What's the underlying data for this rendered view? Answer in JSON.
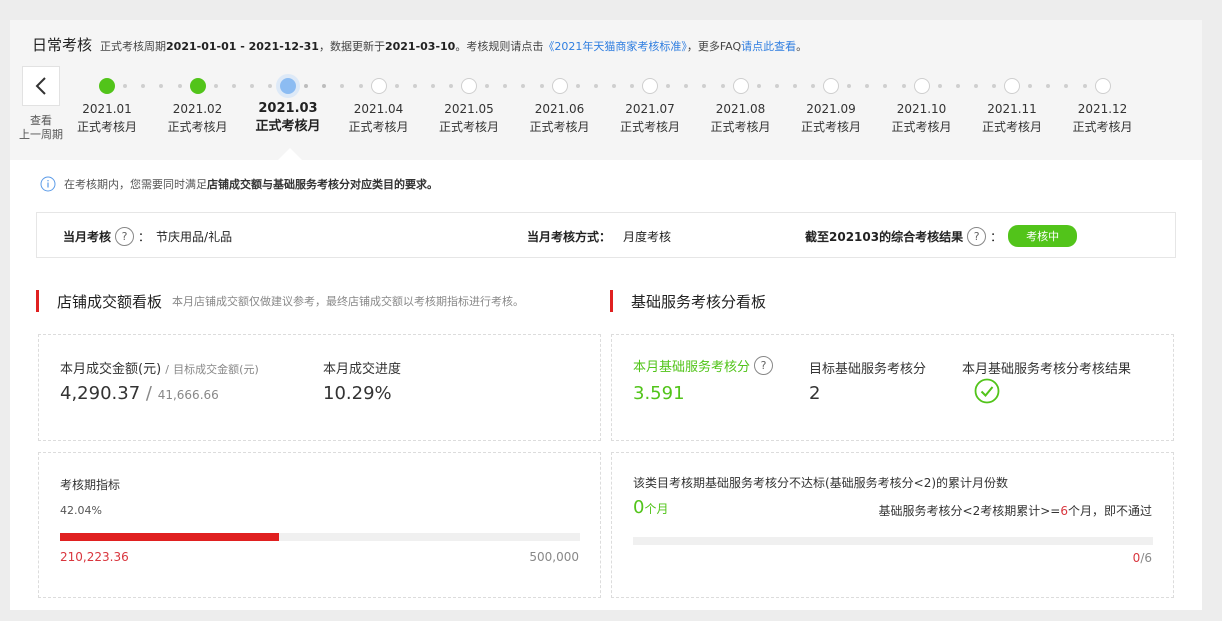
{
  "header": {
    "title": "日常考核",
    "desc_prefix": "正式考核周期",
    "period": "2021-01-01 - 2021-12-31",
    "desc_mid": "，数据更新于",
    "update_date": "2021-03-10",
    "desc_rule": "。考核规则请点击",
    "rule_link": "《2021年天猫商家考核标准》",
    "desc_faq": "，更多FAQ",
    "faq_link": "请点此查看",
    "desc_end": "。"
  },
  "back": {
    "caption_line1": "查看",
    "caption_line2": "上一周期"
  },
  "timeline": {
    "months": [
      {
        "month": "2021.01",
        "label": "正式考核月",
        "status": "done"
      },
      {
        "month": "2021.02",
        "label": "正式考核月",
        "status": "done"
      },
      {
        "month": "2021.03",
        "label": "正式考核月",
        "status": "current"
      },
      {
        "month": "2021.04",
        "label": "正式考核月",
        "status": "future"
      },
      {
        "month": "2021.05",
        "label": "正式考核月",
        "status": "future"
      },
      {
        "month": "2021.06",
        "label": "正式考核月",
        "status": "future"
      },
      {
        "month": "2021.07",
        "label": "正式考核月",
        "status": "future"
      },
      {
        "month": "2021.08",
        "label": "正式考核月",
        "status": "future"
      },
      {
        "month": "2021.09",
        "label": "正式考核月",
        "status": "future"
      },
      {
        "month": "2021.10",
        "label": "正式考核月",
        "status": "future"
      },
      {
        "month": "2021.11",
        "label": "正式考核月",
        "status": "future"
      },
      {
        "month": "2021.12",
        "label": "正式考核月",
        "status": "future"
      }
    ]
  },
  "notice": {
    "prefix": "在考核期内，您需要同时满足",
    "bold": "店铺成交额与基础服务考核分对应类目的要求。"
  },
  "info": {
    "month_label": "当月考核",
    "colon": "：",
    "category": "节庆用品/礼品",
    "method_label": "当月考核方式：",
    "method": "月度考核",
    "result_label": "截至202103的综合考核结果",
    "result_badge": "考核中"
  },
  "sales": {
    "title": "店铺成交额看板",
    "desc": "本月店铺成交额仅做建议参考，最终店铺成交额以考核期指标进行考核。",
    "amount_label": "本月成交金额(元)",
    "slash": "/",
    "target_label": "目标成交金额(元)",
    "amount": "4,290.37",
    "target": "41,666.66",
    "progress_label": "本月成交进度",
    "progress": "10.29%",
    "period_label": "考核期指标",
    "period_percent": "42.04%",
    "period_fraction": 0.4204,
    "period_value": "210,223.36",
    "period_target": "500,000"
  },
  "service": {
    "title": "基础服务考核分看板",
    "score_label": "本月基础服务考核分",
    "score": "3.591",
    "target_label": "目标基础服务考核分",
    "target": "2",
    "result_label": "本月基础服务考核分考核结果",
    "fail_title": "该类目考核期基础服务考核分不达标(基础服务考核分<2)的累计月份数",
    "fail_count": "0",
    "fail_unit": "个月",
    "rule_prefix": "基础服务考核分<2考核期累计>=",
    "rule_num": "6",
    "rule_suffix": "个月，即不通过",
    "fail_fraction": 0,
    "ratio_num": "0",
    "ratio_den": "/6"
  },
  "colors": {
    "green": "#52c41a",
    "red": "#e02020",
    "blue": "#2f7ee0"
  }
}
